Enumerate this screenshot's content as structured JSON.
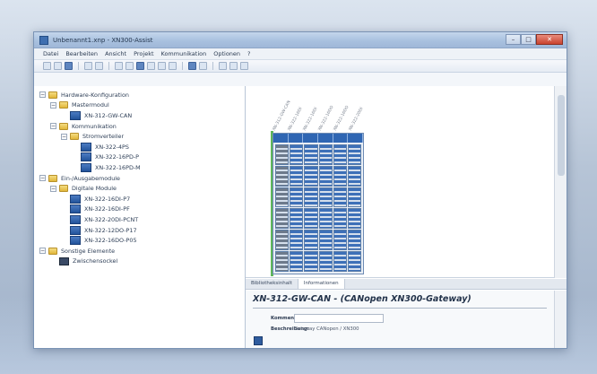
{
  "window": {
    "title": "Unbenannt1.xnp - XN300-Assist",
    "min_glyph": "–",
    "max_glyph": "□",
    "close_glyph": "✕"
  },
  "menu": [
    "Datei",
    "Bearbeiten",
    "Ansicht",
    "Projekt",
    "Kommunikation",
    "Optionen",
    "?"
  ],
  "tree": [
    {
      "level": 0,
      "expander": "−",
      "icon": "folder",
      "label": "Hardware-Konfiguration"
    },
    {
      "level": 1,
      "expander": "−",
      "icon": "folder",
      "label": "Mastermodul"
    },
    {
      "level": 2,
      "expander": "",
      "icon": "device",
      "label": "XN-312-GW-CAN"
    },
    {
      "level": 1,
      "expander": "−",
      "icon": "folder",
      "label": "Kommunikation"
    },
    {
      "level": 2,
      "expander": "−",
      "icon": "folder",
      "label": "Stromverteiler"
    },
    {
      "level": 3,
      "expander": "",
      "icon": "device",
      "label": "XN-322-4PS"
    },
    {
      "level": 3,
      "expander": "",
      "icon": "device",
      "label": "XN-322-16PD-P"
    },
    {
      "level": 3,
      "expander": "",
      "icon": "device",
      "label": "XN-322-16PD-M"
    },
    {
      "level": 0,
      "expander": "−",
      "icon": "folder",
      "label": "Ein-/Ausgabemodule"
    },
    {
      "level": 1,
      "expander": "−",
      "icon": "folder",
      "label": "Digitale Module"
    },
    {
      "level": 2,
      "expander": "",
      "icon": "device",
      "label": "XN-322-16DI-P7"
    },
    {
      "level": 2,
      "expander": "",
      "icon": "device",
      "label": "XN-322-16DI-PF"
    },
    {
      "level": 2,
      "expander": "",
      "icon": "device",
      "label": "XN-322-20DI-PCNT"
    },
    {
      "level": 2,
      "expander": "",
      "icon": "device",
      "label": "XN-322-12DO-P17"
    },
    {
      "level": 2,
      "expander": "",
      "icon": "device",
      "label": "XN-322-16DO-P05"
    },
    {
      "level": 0,
      "expander": "−",
      "icon": "folder",
      "label": "Sonstige Elemente"
    },
    {
      "level": 1,
      "expander": "",
      "icon": "device-dark",
      "label": "Zwischensockel"
    }
  ],
  "canvas": {
    "column_labels": [
      "XN-312-GW-CAN",
      "XN-322-16DI",
      "XN-322-16DI",
      "XN-322-16DO",
      "XN-322-16DO",
      "XN-322-20DI"
    ]
  },
  "tabs": [
    "Bibliotheksinhalt",
    "Informationen"
  ],
  "properties": {
    "title": "XN-312-GW-CAN - (CANopen XN300-Gateway)",
    "name_label": "Kommentar:",
    "name_value": "",
    "description_label": "Beschreibung:",
    "description_value": "Gateway CANopen / XN300"
  }
}
